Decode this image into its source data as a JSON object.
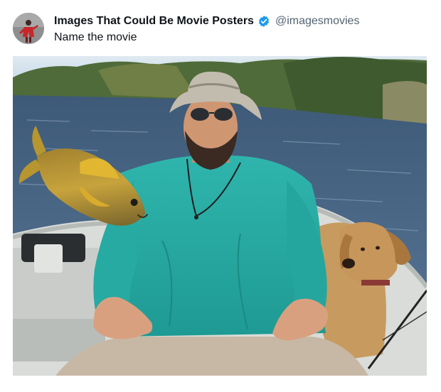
{
  "post": {
    "author_name": "Images That Could Be Movie Posters",
    "author_handle": "@imagesmovies",
    "text": "Name the movie",
    "verified": true
  },
  "icons": {
    "avatar": "avatar-image",
    "verified": "verified-badge-icon"
  },
  "colors": {
    "text_primary": "#0f1419",
    "text_secondary": "#536471",
    "verified_blue": "#1d9bf0"
  }
}
